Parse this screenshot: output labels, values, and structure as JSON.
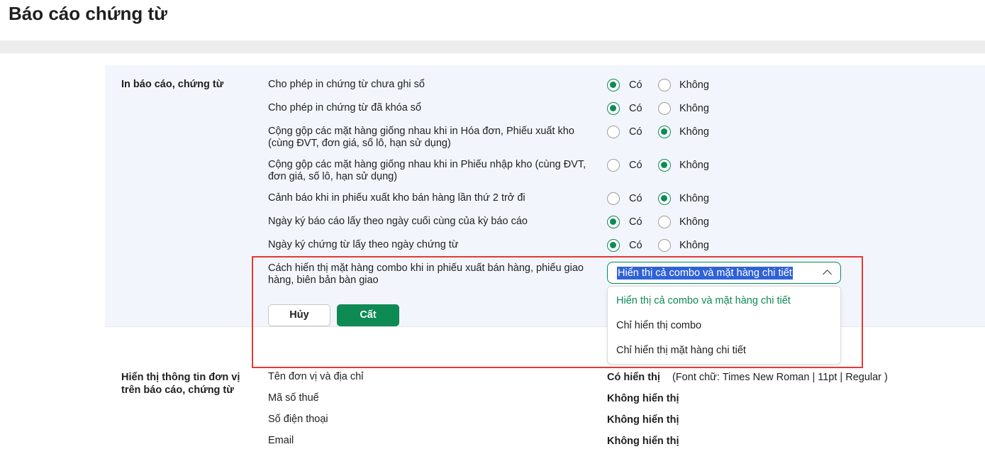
{
  "page": {
    "title": "Báo cáo chứng từ"
  },
  "print_section": {
    "label": "In báo cáo, chứng từ",
    "options_yes": "Có",
    "options_no": "Không",
    "rows": [
      {
        "label": "Cho phép in chứng từ chưa ghi sổ",
        "selected": "Có"
      },
      {
        "label": "Cho phép in chứng từ đã khóa sổ",
        "selected": "Có"
      },
      {
        "label": "Cộng gộp các mặt hàng giống nhau khi in Hóa đơn, Phiếu xuất kho (cùng ĐVT, đơn giá, số lô, hạn sử dụng)",
        "selected": "Không"
      },
      {
        "label": "Cộng gộp các mặt hàng giống nhau khi in Phiếu nhập kho (cùng ĐVT, đơn giá, số lô, hạn sử dụng)",
        "selected": "Không"
      },
      {
        "label": "Cảnh báo khi in phiếu xuất kho bán hàng lần thứ 2 trở đi",
        "selected": "Không"
      },
      {
        "label": "Ngày ký báo cáo lấy theo ngày cuối cùng của kỳ báo cáo",
        "selected": "Có"
      },
      {
        "label": "Ngày ký chứng từ lấy theo ngày chứng từ",
        "selected": "Có"
      }
    ],
    "combo_setting": {
      "label": "Cách hiển thị mặt hàng combo khi in phiếu xuất bán hàng, phiếu giao hàng, biên bản bàn giao",
      "value": "Hiển thị cả combo và mặt hàng chi tiết",
      "options": [
        "Hiển thị cả combo và mặt hàng chi tiết",
        "Chỉ hiển thị combo",
        "Chỉ hiển thị mặt hàng chi tiết"
      ]
    },
    "cancel_label": "Hủy",
    "save_label": "Cất"
  },
  "display_section": {
    "label": "Hiển thị thông tin đơn vị trên báo cáo, chứng từ",
    "rows": [
      {
        "label": "Tên đơn vị và địa chỉ",
        "value": "Có hiển thị",
        "extra": "(Font chữ: Times New Roman | 11pt | Regular )"
      },
      {
        "label": "Mã số thuế",
        "value": "Không hiển thị"
      },
      {
        "label": "Số điện thoại",
        "value": "Không hiển thị"
      },
      {
        "label": "Email",
        "value": "Không hiển thị"
      }
    ]
  },
  "colors": {
    "accent": "#0e8a55",
    "highlight_box": "#e53935",
    "section_bg": "#f2f6fc"
  }
}
